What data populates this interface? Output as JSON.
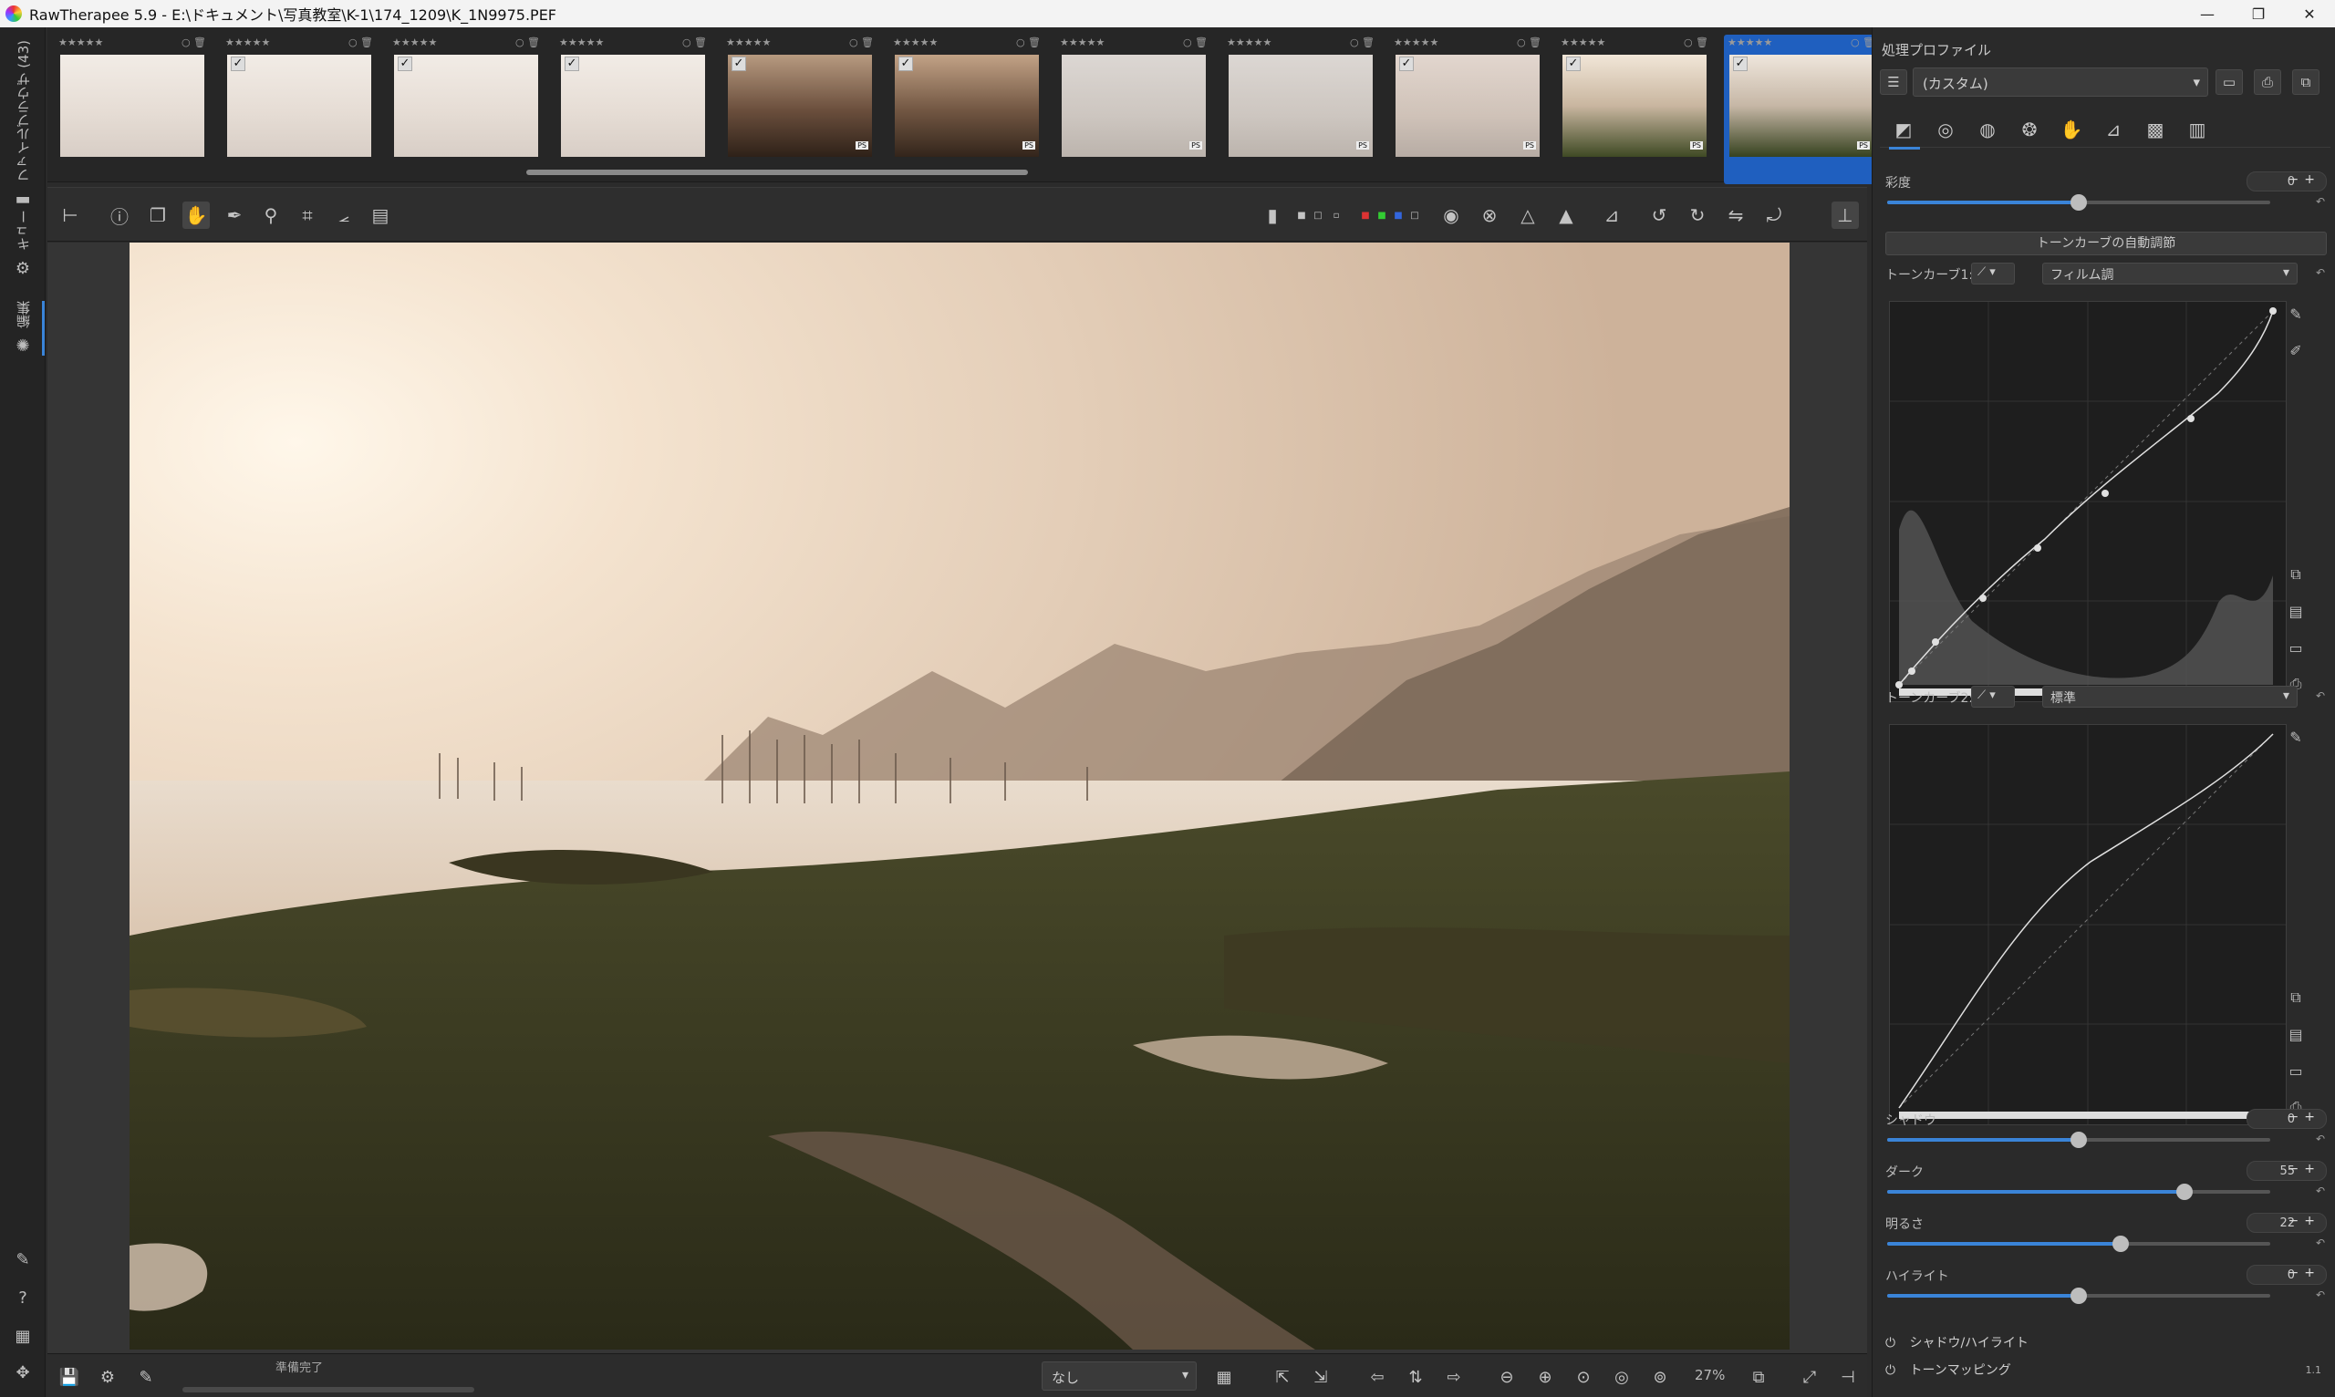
{
  "window": {
    "title": "RawTherapee 5.9 - E:\\ドキュメント\\写真教室\\K-1\\174_1209\\K_1N9975.PEF",
    "controls": [
      "—",
      "❐",
      "✕"
    ]
  },
  "left_tabs": [
    {
      "label": "ファイルブラウザ (43)"
    },
    {
      "label": "キュー"
    },
    {
      "label": "編集"
    }
  ],
  "filmstrip": {
    "thumbs": [
      {
        "stars": "★★★★★",
        "checked": false,
        "ps": false,
        "tone": "pale"
      },
      {
        "stars": "★★★★★",
        "checked": true,
        "ps": false,
        "tone": "pale"
      },
      {
        "stars": "★★★★★",
        "checked": true,
        "ps": false,
        "tone": "pale"
      },
      {
        "stars": "★★★★★",
        "checked": true,
        "ps": false,
        "tone": "pale"
      },
      {
        "stars": "★★★★★",
        "checked": true,
        "ps": true,
        "tone": "sunset"
      },
      {
        "stars": "★★★★★",
        "checked": true,
        "ps": true,
        "tone": "sunset2"
      },
      {
        "stars": "★★★★★",
        "checked": false,
        "ps": true,
        "tone": "fog"
      },
      {
        "stars": "★★★★★",
        "checked": false,
        "ps": true,
        "tone": "fog"
      },
      {
        "stars": "★★★★★",
        "checked": true,
        "ps": true,
        "tone": "fog2"
      },
      {
        "stars": "★★★★★",
        "checked": true,
        "ps": true,
        "tone": "moss"
      },
      {
        "stars": "★★★★★",
        "checked": true,
        "ps": true,
        "tone": "moss2",
        "selected": true
      }
    ],
    "ps_badge": "PS"
  },
  "statusbar": {
    "status": "準備完了",
    "preset": "なし",
    "zoom": "27%"
  },
  "right_panel": {
    "title": "処理プロファイル",
    "profile": "(カスタム)",
    "saturation": {
      "label": "彩度",
      "value": "0",
      "fraction": 0.5
    },
    "auto_button": "トーンカーブの自動調節",
    "curve1": {
      "label": "トーンカーブ1:",
      "mode": "フィルム調"
    },
    "curve2": {
      "label": "トーンカーブ2:",
      "mode": "標準"
    },
    "sliders": [
      {
        "label": "シャドウ",
        "value": "0",
        "fraction": 0.5
      },
      {
        "label": "ダーク",
        "value": "55",
        "fraction": 0.775
      },
      {
        "label": "明るさ",
        "value": "22",
        "fraction": 0.61
      },
      {
        "label": "ハイライト",
        "value": "0",
        "fraction": 0.5
      }
    ],
    "sections": [
      {
        "label": "シャドウ/ハイライト"
      },
      {
        "label": "トーンマッピング",
        "version": "1.1"
      }
    ]
  },
  "colors": {
    "accent": "#3a84d8",
    "selected_thumb": "#1f5fbf"
  }
}
